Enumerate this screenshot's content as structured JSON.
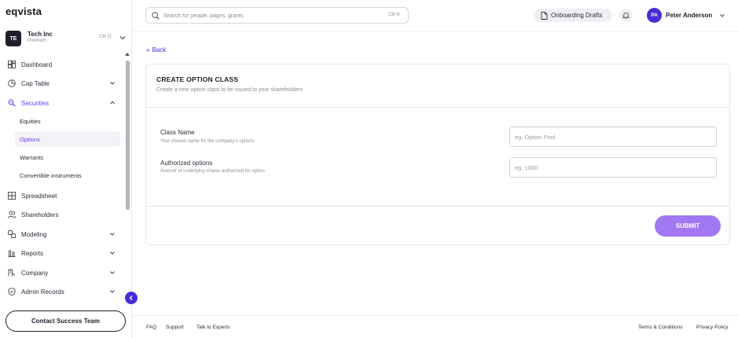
{
  "brand": {
    "logo_text": "eqvista",
    "accent": "#4a2cd6",
    "active_color": "#6c3ee8"
  },
  "company": {
    "initials": "TE",
    "name": "Tech Inc",
    "plan": "Premium",
    "shortcut": "Ctrl O",
    "icon": "chevron-down-icon"
  },
  "sidebar": {
    "items": [
      {
        "label": "Dashboard",
        "icon": "dashboard-icon"
      },
      {
        "label": "Cap Table",
        "icon": "pie-chart-icon",
        "chevron": "down"
      },
      {
        "label": "Securities",
        "icon": "securities-icon",
        "chevron": "up",
        "active": true,
        "children": [
          {
            "label": "Equities"
          },
          {
            "label": "Options",
            "selected": true
          },
          {
            "label": "Warrants"
          },
          {
            "label": "Convertible instruments"
          }
        ]
      },
      {
        "label": "Spreadsheet",
        "icon": "grid-icon"
      },
      {
        "label": "Shareholders",
        "icon": "users-icon"
      },
      {
        "label": "Modeling",
        "icon": "modeling-icon",
        "chevron": "down"
      },
      {
        "label": "Reports",
        "icon": "bar-chart-icon",
        "chevron": "down"
      },
      {
        "label": "Company",
        "icon": "company-icon",
        "chevron": "down"
      },
      {
        "label": "Admin Records",
        "icon": "shield-icon",
        "chevron": "down"
      }
    ],
    "contact_button": "Contact Success Team"
  },
  "topbar": {
    "search": {
      "placeholder": "Search for people, pages, grants",
      "shortcut": "Ctrl K"
    },
    "drafts_label": "Onboarding Drafts",
    "user": {
      "initials": "PA",
      "name": "Peter Anderson"
    }
  },
  "main": {
    "back_label": "Back",
    "card": {
      "title": "CREATE OPTION CLASS",
      "subtitle": "Create a new option class to be issued to your shareholders",
      "fields": [
        {
          "label": "Class Name",
          "help": "Your chosen name for the company's options",
          "placeholder": "eg. Option Pool"
        },
        {
          "label": "Authorized options",
          "help": "Amount of underlying shares authorized for option",
          "placeholder": "eg. 1000"
        }
      ],
      "submit_label": "SUBMIT"
    }
  },
  "footer": {
    "left_links": [
      "FAQ",
      "Support",
      "Talk to Experts"
    ],
    "right_links": [
      "Terms & Conditions",
      "Privacy Policy"
    ]
  }
}
